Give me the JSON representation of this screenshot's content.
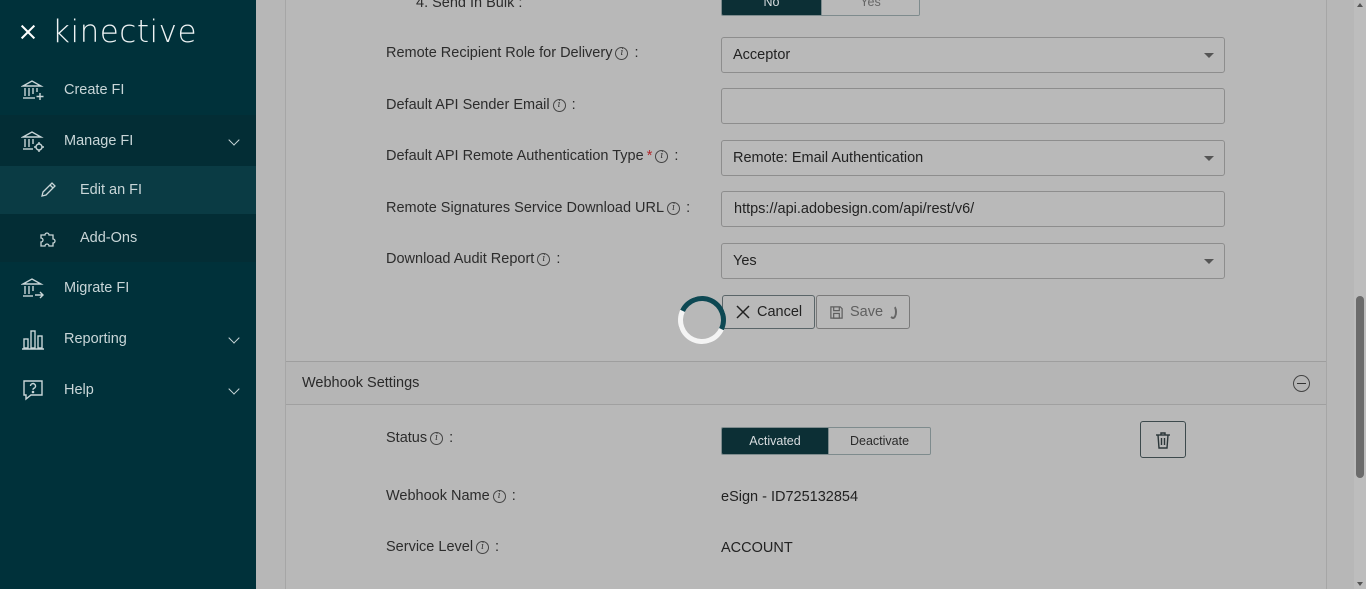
{
  "sidebar": {
    "logo": "kinective",
    "items": [
      {
        "label": "Create FI",
        "icon": "bank-plus-icon"
      },
      {
        "label": "Manage FI",
        "icon": "bank-gear-icon"
      },
      {
        "label": "Edit an FI",
        "icon": "pencil-icon"
      },
      {
        "label": "Add-Ons",
        "icon": "puzzle-icon"
      },
      {
        "label": "Migrate FI",
        "icon": "bank-arrow-icon"
      },
      {
        "label": "Reporting",
        "icon": "bar-chart-icon"
      },
      {
        "label": "Help",
        "icon": "help-bubble-icon"
      }
    ]
  },
  "form": {
    "send_bulk": {
      "label": "4. Send In Bulk :",
      "options": [
        "No",
        "Yes"
      ],
      "selected": "No"
    },
    "remote_role": {
      "label": "Remote Recipient Role for Delivery",
      "value": "Acceptor"
    },
    "sender_email": {
      "label": "Default API Sender Email",
      "value": ""
    },
    "auth_type": {
      "label": "Default API Remote Authentication Type",
      "required": "*",
      "value": "Remote: Email Authentication"
    },
    "download_url": {
      "label": "Remote Signatures Service Download URL",
      "value": "https://api.adobesign.com/api/rest/v6/"
    },
    "audit_report": {
      "label": "Download Audit Report",
      "value": "Yes"
    },
    "cancel_label": "Cancel",
    "save_label": "Save"
  },
  "webhook": {
    "title": "Webhook Settings",
    "status_label": "Status",
    "status_options": [
      "Activated",
      "Deactivate"
    ],
    "status_selected": "Activated",
    "name_label": "Webhook Name",
    "name_value": "eSign - ID725132854",
    "service_label": "Service Level",
    "service_value": "ACCOUNT"
  },
  "colors": {
    "sidebar_bg": "#00313a",
    "accent": "#0c2f35",
    "overlay": "#b7b7b7",
    "required": "#b3262b"
  }
}
